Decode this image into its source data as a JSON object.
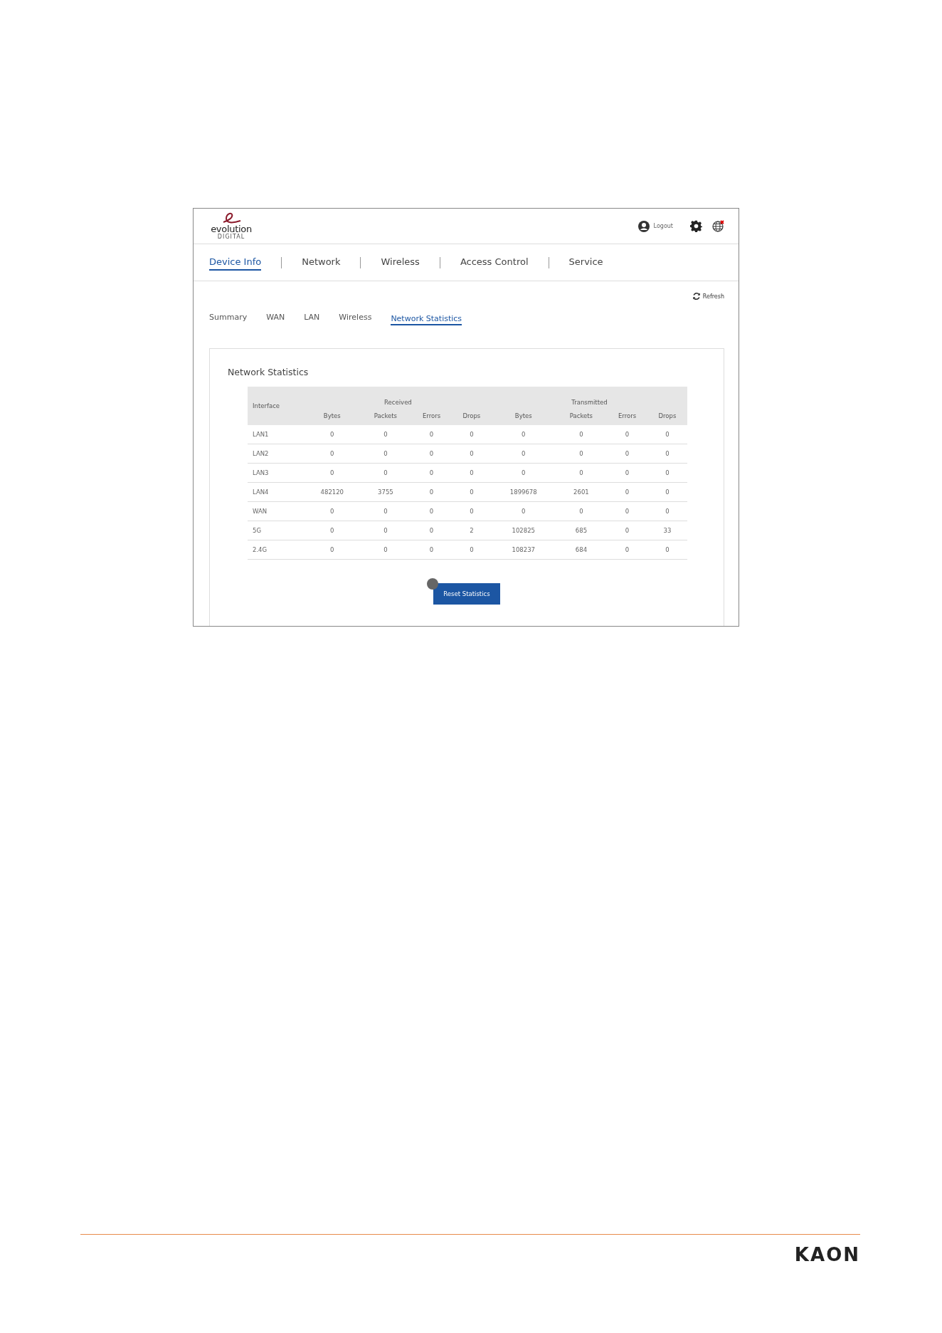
{
  "header": {
    "logo": {
      "wordmark": "evolution",
      "subtitle": "DIGITAL"
    },
    "logout": "Logout"
  },
  "nav": [
    {
      "label": "Device Info",
      "selected": true
    },
    {
      "label": "Network",
      "selected": false
    },
    {
      "label": "Wireless",
      "selected": false
    },
    {
      "label": "Access Control",
      "selected": false
    },
    {
      "label": "Service",
      "selected": false
    }
  ],
  "refresh": "Refresh",
  "subtabs": [
    {
      "label": "Summary",
      "selected": false
    },
    {
      "label": "WAN",
      "selected": false
    },
    {
      "label": "LAN",
      "selected": false
    },
    {
      "label": "Wireless",
      "selected": false
    },
    {
      "label": "Network Statistics",
      "selected": true
    }
  ],
  "panel": {
    "title": "Network Statistics",
    "table": {
      "groups": [
        "Received",
        "Transmitted"
      ],
      "columns": [
        "Interface",
        "Bytes",
        "Packets",
        "Errors",
        "Drops",
        "Bytes",
        "Packets",
        "Errors",
        "Drops"
      ],
      "rows": [
        [
          "LAN1",
          "0",
          "0",
          "0",
          "0",
          "0",
          "0",
          "0",
          "0"
        ],
        [
          "LAN2",
          "0",
          "0",
          "0",
          "0",
          "0",
          "0",
          "0",
          "0"
        ],
        [
          "LAN3",
          "0",
          "0",
          "0",
          "0",
          "0",
          "0",
          "0",
          "0"
        ],
        [
          "LAN4",
          "482120",
          "3755",
          "0",
          "0",
          "1899678",
          "2601",
          "0",
          "0"
        ],
        [
          "WAN",
          "0",
          "0",
          "0",
          "0",
          "0",
          "0",
          "0",
          "0"
        ],
        [
          "5G",
          "0",
          "0",
          "0",
          "2",
          "102825",
          "685",
          "0",
          "33"
        ],
        [
          "2.4G",
          "0",
          "0",
          "0",
          "0",
          "108237",
          "684",
          "0",
          "0"
        ]
      ]
    },
    "button": "Reset Statistics"
  },
  "footer": {
    "brand": "KAON"
  }
}
